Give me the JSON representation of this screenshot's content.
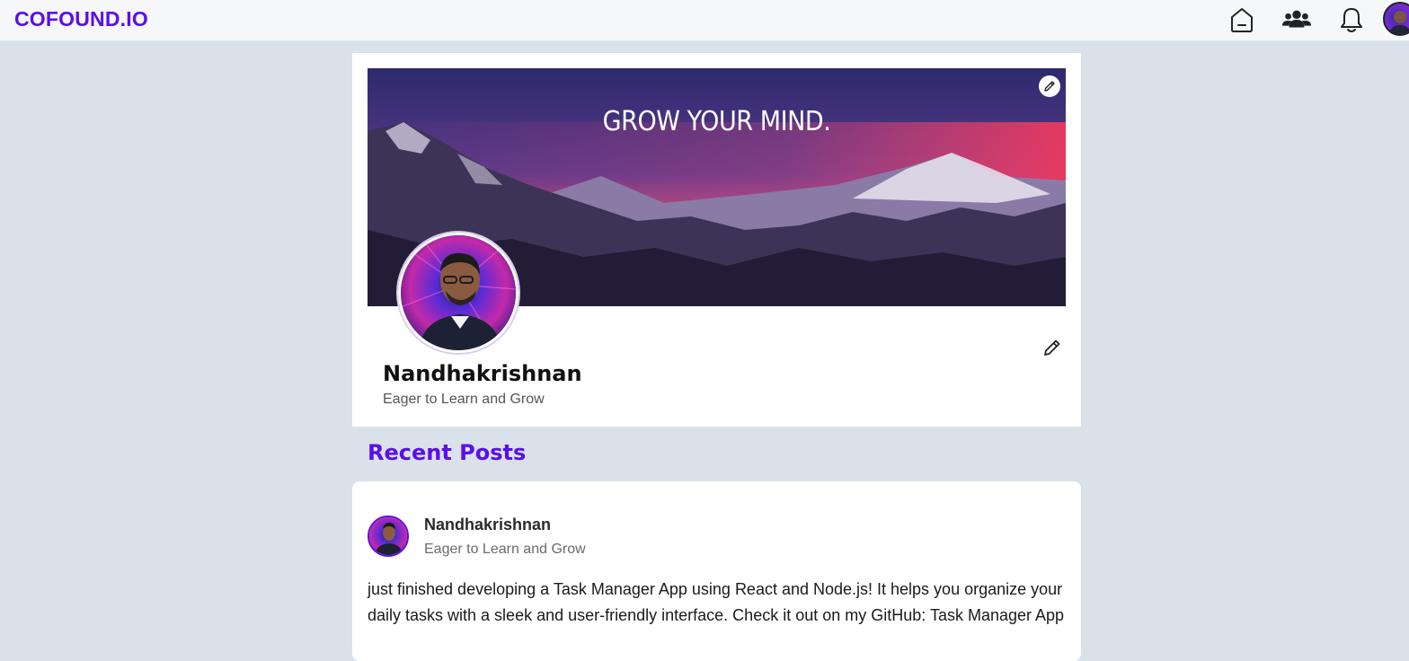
{
  "app": {
    "brand": "COFOUND.IO",
    "accent_color": "#5b0fe8"
  },
  "nav": {
    "icons": [
      "home-icon",
      "users-icon",
      "bell-icon"
    ],
    "avatar": "user-avatar"
  },
  "profile": {
    "cover_text": "GROW YOUR MIND.",
    "name": "Nandhakrishnan",
    "tagline": "Eager to Learn and Grow"
  },
  "posts_section": {
    "title": "Recent Posts"
  },
  "posts": [
    {
      "author": "Nandhakrishnan",
      "author_tagline": "Eager to Learn and Grow",
      "text": "just finished developing a Task Manager App using React and Node.js! It helps you organize your daily tasks with a sleek and user-friendly interface. Check it out on my GitHub: Task Manager App"
    }
  ]
}
